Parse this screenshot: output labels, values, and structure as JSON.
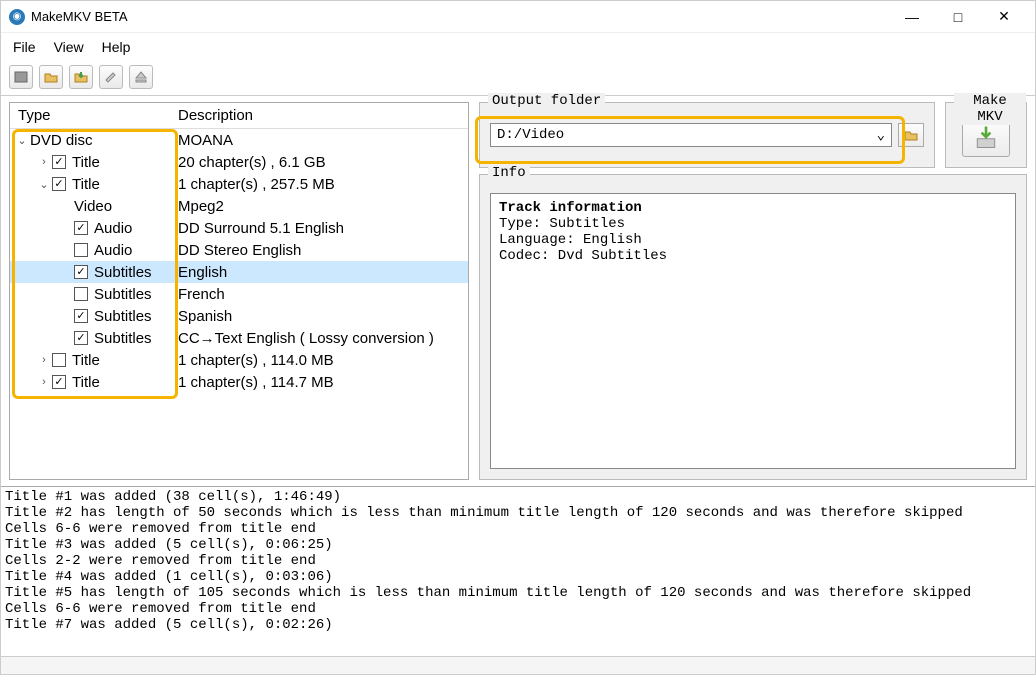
{
  "window": {
    "title": "MakeMKV BETA"
  },
  "menu": {
    "file": "File",
    "view": "View",
    "help": "Help"
  },
  "tree": {
    "header_type": "Type",
    "header_desc": "Description",
    "rows": [
      {
        "indent": 0,
        "expand": "down",
        "checkbox": null,
        "label": "DVD disc",
        "desc": "MOANA"
      },
      {
        "indent": 1,
        "expand": "right",
        "checkbox": true,
        "label": "Title",
        "desc": "20 chapter(s) , 6.1 GB"
      },
      {
        "indent": 1,
        "expand": "down",
        "checkbox": true,
        "label": "Title",
        "desc": "1 chapter(s) , 257.5 MB"
      },
      {
        "indent": 2,
        "expand": null,
        "checkbox": null,
        "label": "Video",
        "desc": "Mpeg2"
      },
      {
        "indent": 2,
        "expand": null,
        "checkbox": true,
        "label": "Audio",
        "desc": "DD Surround 5.1 English"
      },
      {
        "indent": 2,
        "expand": null,
        "checkbox": false,
        "label": "Audio",
        "desc": "DD Stereo English"
      },
      {
        "indent": 2,
        "expand": null,
        "checkbox": true,
        "label": "Subtitles",
        "desc": "English",
        "selected": true
      },
      {
        "indent": 2,
        "expand": null,
        "checkbox": false,
        "label": "Subtitles",
        "desc": "French"
      },
      {
        "indent": 2,
        "expand": null,
        "checkbox": true,
        "label": "Subtitles",
        "desc": "Spanish"
      },
      {
        "indent": 2,
        "expand": null,
        "checkbox": true,
        "label": "Subtitles",
        "desc": "CC→Text English ( Lossy conversion )"
      },
      {
        "indent": 1,
        "expand": "right",
        "checkbox": false,
        "label": "Title",
        "desc": "1 chapter(s) , 114.0 MB"
      },
      {
        "indent": 1,
        "expand": "right",
        "checkbox": true,
        "label": "Title",
        "desc": "1 chapter(s) , 114.7 MB"
      }
    ]
  },
  "output": {
    "legend": "Output folder",
    "value": "D:/Video"
  },
  "make": {
    "legend": "Make MKV"
  },
  "info": {
    "legend": "Info",
    "text": "Track information\nType: Subtitles\nLanguage: English\nCodec: Dvd Subtitles"
  },
  "log": "Title #1 was added (38 cell(s), 1:46:49)\nTitle #2 has length of 50 seconds which is less than minimum title length of 120 seconds and was therefore skipped\nCells 6-6 were removed from title end\nTitle #3 was added (5 cell(s), 0:06:25)\nCells 2-2 were removed from title end\nTitle #4 was added (1 cell(s), 0:03:06)\nTitle #5 has length of 105 seconds which is less than minimum title length of 120 seconds and was therefore skipped\nCells 6-6 were removed from title end\nTitle #7 was added (5 cell(s), 0:02:26)"
}
